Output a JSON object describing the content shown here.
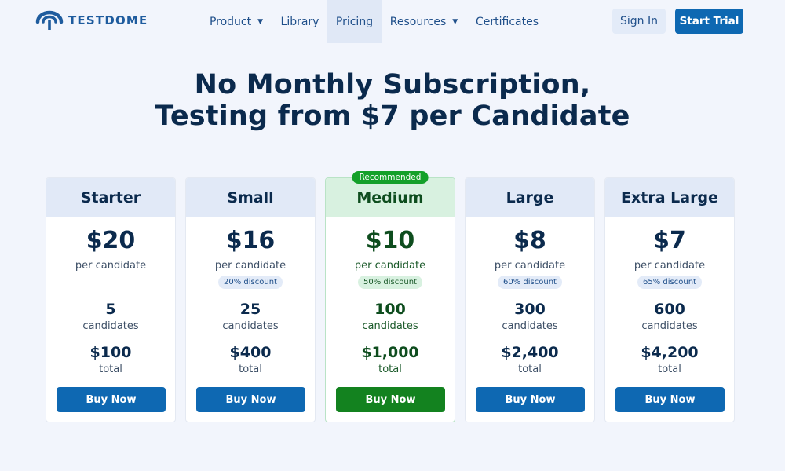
{
  "brand": {
    "name": "TESTDOME",
    "color": "#1f5c9e"
  },
  "nav": {
    "items": [
      {
        "label": "Product",
        "has_dropdown": true
      },
      {
        "label": "Library",
        "has_dropdown": false
      },
      {
        "label": "Pricing",
        "has_dropdown": false,
        "active": true
      },
      {
        "label": "Resources",
        "has_dropdown": true
      },
      {
        "label": "Certificates",
        "has_dropdown": false
      }
    ],
    "sign_in": "Sign In",
    "start_trial": "Start Trial"
  },
  "headline": {
    "line1": "No Monthly Subscription,",
    "line2": "Testing from $7 per Candidate"
  },
  "plans": [
    {
      "name": "Starter",
      "price": "$20",
      "per": "per candidate",
      "discount": "",
      "count": "5",
      "count_label": "candidates",
      "total": "$100",
      "total_label": "total",
      "button": "Buy Now"
    },
    {
      "name": "Small",
      "price": "$16",
      "per": "per candidate",
      "discount": "20% discount",
      "count": "25",
      "count_label": "candidates",
      "total": "$400",
      "total_label": "total",
      "button": "Buy Now"
    },
    {
      "name": "Medium",
      "price": "$10",
      "per": "per candidate",
      "discount": "50% discount",
      "count": "100",
      "count_label": "candidates",
      "total": "$1,000",
      "total_label": "total",
      "button": "Buy Now",
      "badge": "Recommended"
    },
    {
      "name": "Large",
      "price": "$8",
      "per": "per candidate",
      "discount": "60% discount",
      "count": "300",
      "count_label": "candidates",
      "total": "$2,400",
      "total_label": "total",
      "button": "Buy Now"
    },
    {
      "name": "Extra Large",
      "price": "$7",
      "per": "per candidate",
      "discount": "65% discount",
      "count": "600",
      "count_label": "candidates",
      "total": "$4,200",
      "total_label": "total",
      "button": "Buy Now"
    }
  ],
  "colors": {
    "accent": "#0e68b2",
    "recommended": "#13821f",
    "background": "#f2f5fc",
    "heading": "#0b2a4d"
  }
}
